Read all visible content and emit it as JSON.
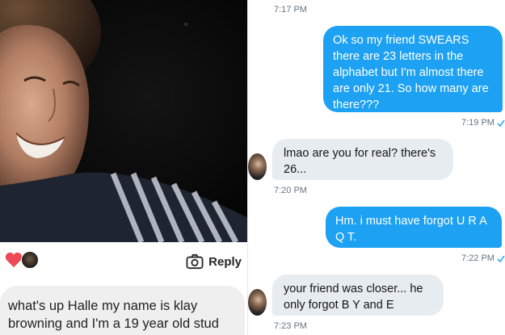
{
  "left": {
    "reply_label": "Reply",
    "message_line1": "what's up Halle my name is klay",
    "message_line2": "browning and I'm a 19 year old stud"
  },
  "right": {
    "messages": [
      {
        "time": "7:17 PM"
      },
      {
        "direction": "out",
        "lines": [
          "Ok so my friend SWEARS",
          "there are 23 letters in the",
          "alphabet but I'm almost there",
          "are only 21. So how many are",
          "there???"
        ],
        "time": "7:19 PM"
      },
      {
        "direction": "in",
        "lines": [
          "lmao are you for real? there's",
          "26..."
        ],
        "time": "7:20 PM"
      },
      {
        "direction": "out",
        "lines": [
          "Hm. i must have forgot U R A",
          "Q T."
        ],
        "time": "7:22 PM"
      },
      {
        "direction": "in",
        "lines": [
          "your friend was closer... he",
          "only forgot B Y and E"
        ],
        "time": "7:23 PM"
      }
    ]
  },
  "colors": {
    "outgoing_bubble": "#1da1f2",
    "incoming_bubble": "#e6ecf0",
    "timestamp": "#66757f",
    "heart": "#ed4956"
  },
  "icons": [
    "heart-icon",
    "camera-icon",
    "read-check-icon"
  ]
}
